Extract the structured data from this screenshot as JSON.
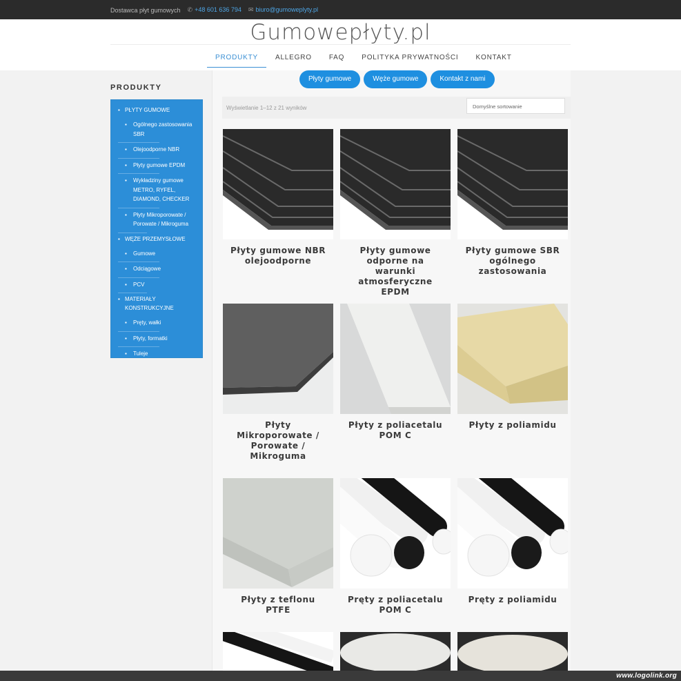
{
  "topbar": {
    "tagline": "Dostawca płyt gumowych",
    "phone": "+48 601 636 794",
    "email": "biuro@gumoweplyty.pl",
    "phone_icon": "phone-icon",
    "email_icon": "envelope-icon"
  },
  "header": {
    "logo": "Gumowepłyty.pl"
  },
  "nav": {
    "items": [
      {
        "label": "PRODUKTY",
        "active": true
      },
      {
        "label": "ALLEGRO"
      },
      {
        "label": "FAQ"
      },
      {
        "label": "POLITYKA PRYWATNOŚCI"
      },
      {
        "label": "KONTAKT"
      }
    ]
  },
  "pills": [
    {
      "label": "Płyty gumowe"
    },
    {
      "label": "Węże gumowe"
    },
    {
      "label": "Kontakt z nami"
    }
  ],
  "sidebar": {
    "title": "PRODUKTY",
    "cat1": "PŁYTY GUMOWE",
    "cat1_items": [
      "Ogólnego zastosowania SBR",
      "Olejoodporne NBR",
      "Płyty gumowe EPDM",
      "Wykładziny gumowe METRO, RYFEL, DIAMOND, CHECKER",
      "Płyty Mikroporowate / Porowate / Mikroguma"
    ],
    "cat2": "WĘŻE PRZEMYSŁOWE",
    "cat2_items": [
      "Gumowe",
      "Odciągowe",
      "PCV"
    ],
    "cat3": "MATERIAŁY KONSTRUKCYJNE",
    "cat3_items": [
      "Pręty, wałki",
      "Płyty, formatki",
      "Tuleje"
    ]
  },
  "shop": {
    "result_count": "Wyświetlanie 1–12 z 21 wyników",
    "sort_label": "Domyślne sortowanie"
  },
  "products": [
    {
      "title": "Płyty gumowe NBR olejoodporne"
    },
    {
      "title": "Płyty gumowe odporne na warunki atmosferyczne EPDM"
    },
    {
      "title": "Płyty gumowe SBR ogólnego zastosowania"
    },
    {
      "title": "Płyty Mikroporowate / Porowate / Mikroguma"
    },
    {
      "title": "Płyty z poliacetalu POM C"
    },
    {
      "title": "Płyty z poliamidu"
    },
    {
      "title": "Płyty z teflonu PTFE"
    },
    {
      "title": "Pręty z poliacetalu POM C"
    },
    {
      "title": "Pręty z poliamidu"
    }
  ],
  "watermark": "www.logolink.org",
  "colors": {
    "accent": "#1e8fe0",
    "sidebar": "#2c8ed8",
    "topbar": "#2b2b2b"
  }
}
